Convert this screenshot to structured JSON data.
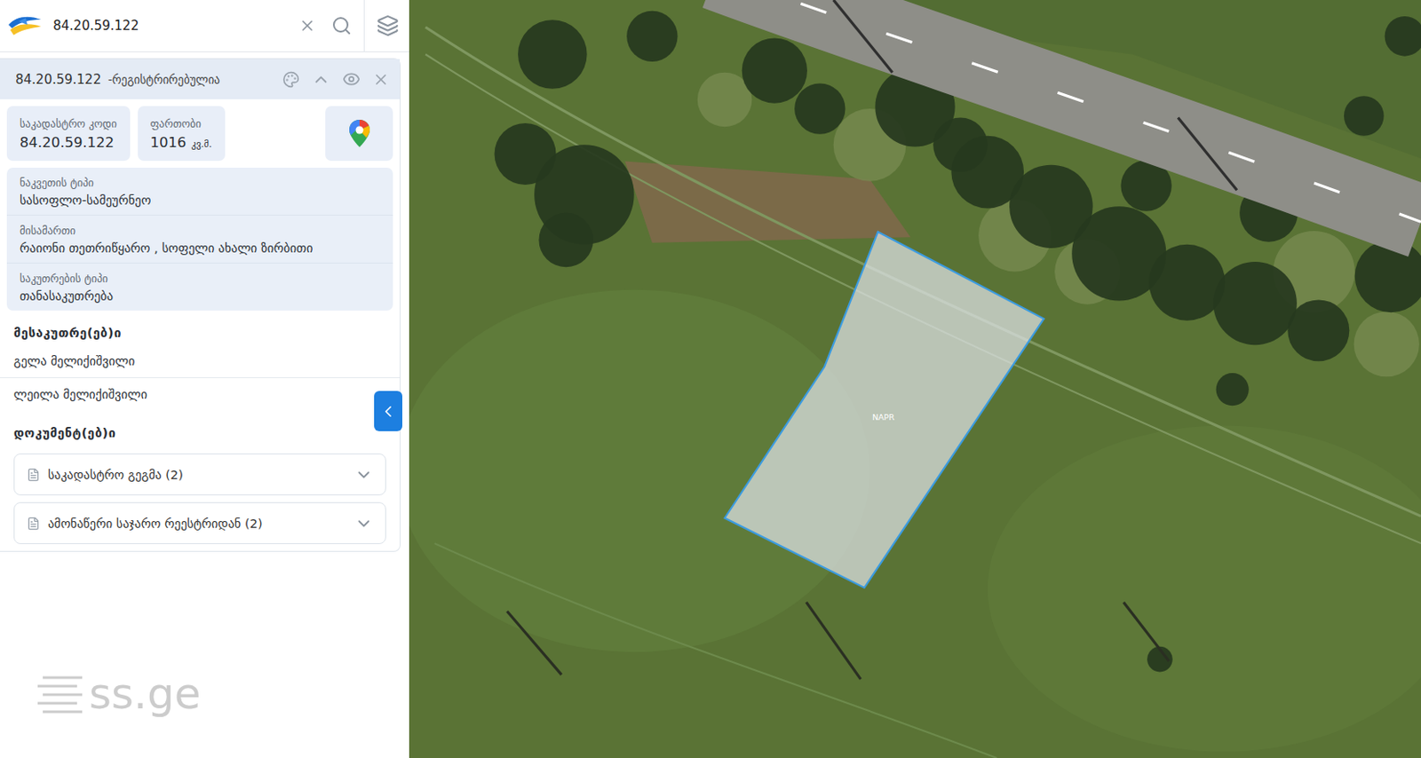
{
  "search": {
    "value": "84.20.59.122"
  },
  "parcel": {
    "code": "84.20.59.122",
    "status": "-რეგისტრირებულია",
    "expanded": true,
    "visible": true
  },
  "stats": [
    {
      "label": "საკადასტრო კოდი",
      "value": "84.20.59.122"
    },
    {
      "label": "ფართობი",
      "value": "1016",
      "unit": "კვ.მ."
    }
  ],
  "details": [
    {
      "label": "ნაკვეთის ტიპი",
      "value": "სასოფლო-სამეურნეო"
    },
    {
      "label": "მისამართი",
      "value": "რაიონი თეთრიწყარო , სოფელი ახალი ზირბითი"
    },
    {
      "label": "საკუთრების ტიპი",
      "value": "თანასაკუთრება"
    }
  ],
  "owners": {
    "title": "მესაკუთრე(ებ)ი",
    "items": [
      "გელა მელიქიშვილი",
      "ლეილა მელიქიშვილი"
    ]
  },
  "documents": {
    "title": "დოკუმენტ(ებ)ი",
    "items": [
      {
        "label": "საკადასტრო გეგმა (2)",
        "expanded": false
      },
      {
        "label": "ამონაწერი საჯარო რეესტრიდან (2)",
        "expanded": false
      }
    ]
  },
  "panel": {
    "collapsed": false
  },
  "map": {
    "parcel_label": "NAPR"
  },
  "watermark": "ss.ge"
}
